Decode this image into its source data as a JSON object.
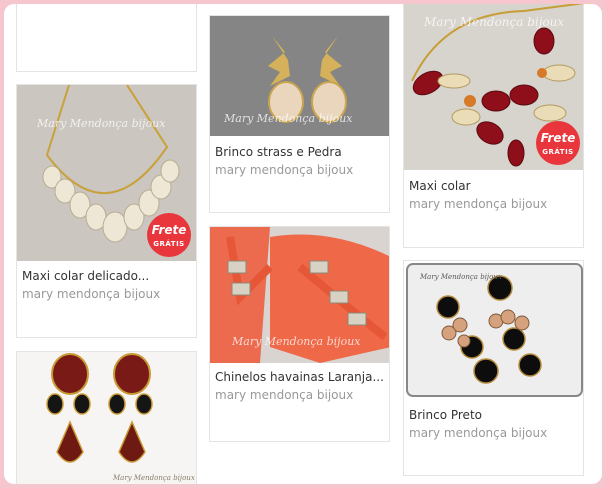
{
  "products": [
    {
      "title": "Maxi colar delicado...",
      "seller": "mary mendonça bijoux",
      "badge": {
        "line1": "Frete",
        "line2": "GRÁTIS"
      },
      "watermark": "Mary Mendonça bijoux"
    },
    {
      "title": "Brinco strass e Pedra",
      "seller": "mary mendonça bijoux",
      "watermark": "Mary Mendonça bijoux"
    },
    {
      "title": "Chinelos havainas Laranja...",
      "seller": "mary mendonça bijoux",
      "watermark": "Mary Mendonça bijoux"
    },
    {
      "title": "Maxi colar",
      "seller": "mary mendonça bijoux",
      "badge": {
        "line1": "Frete",
        "line2": "GRÁTIS"
      },
      "watermark": "Mary Mendonça bijoux"
    },
    {
      "title": "Brinco Preto",
      "seller": "mary mendonça bijoux",
      "watermark": "Mary Mendonça bijoux"
    },
    {
      "watermark": "Mary Mendonça bijoux"
    }
  ],
  "colors": {
    "accent": "#e9363d",
    "page_border": "#f6c6cf"
  }
}
